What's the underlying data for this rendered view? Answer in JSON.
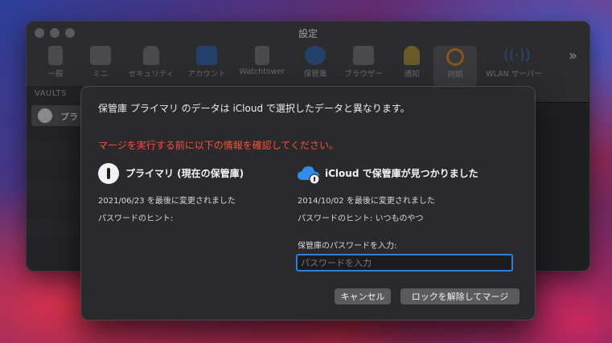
{
  "window": {
    "title": "設定",
    "toolbar": [
      {
        "label": "一般",
        "icon": "phone-icon"
      },
      {
        "label": "ミニ",
        "icon": "mini-icon"
      },
      {
        "label": "セキュリティ",
        "icon": "lock-icon"
      },
      {
        "label": "アカウント",
        "icon": "flag-icon"
      },
      {
        "label": "Watchtower",
        "icon": "tower-icon"
      },
      {
        "label": "保管庫",
        "icon": "vault-icon"
      },
      {
        "label": "ブラウザー",
        "icon": "browser-icon"
      },
      {
        "label": "通知",
        "icon": "bell-icon"
      },
      {
        "label": "同期",
        "icon": "sync-icon",
        "active": true
      },
      {
        "label": "WLAN サーバー",
        "icon": "wifi-icon"
      }
    ],
    "more": "»"
  },
  "sidebar": {
    "header": "VAULTS",
    "selected": "プラ"
  },
  "dialog": {
    "message": "保管庫 プライマリ のデータは iCloud で選択したデータと異なります。",
    "warning": "マージを実行する前に以下の情報を確認してください。",
    "local": {
      "title": "プライマリ (現在の保管庫)",
      "modified": "2021/06/23 を最後に変更されました",
      "hint_label": "パスワードのヒント:"
    },
    "icloud": {
      "title": "iCloud で保管庫が見つかりました",
      "modified": "2014/10/02 を最後に変更されました",
      "hint_label": "パスワードのヒント:",
      "hint_value": "いつものやつ",
      "password_label": "保管庫のパスワードを入力:",
      "password_placeholder": "パスワードを入力"
    },
    "cancel": "キャンセル",
    "unlock_merge": "ロックを解除してマージ"
  },
  "colors": {
    "warning": "#ff4d3a",
    "focus_ring": "#2e7fd8",
    "sync_icon": "#e8882a",
    "cloud_icon": "#2f8df0"
  }
}
